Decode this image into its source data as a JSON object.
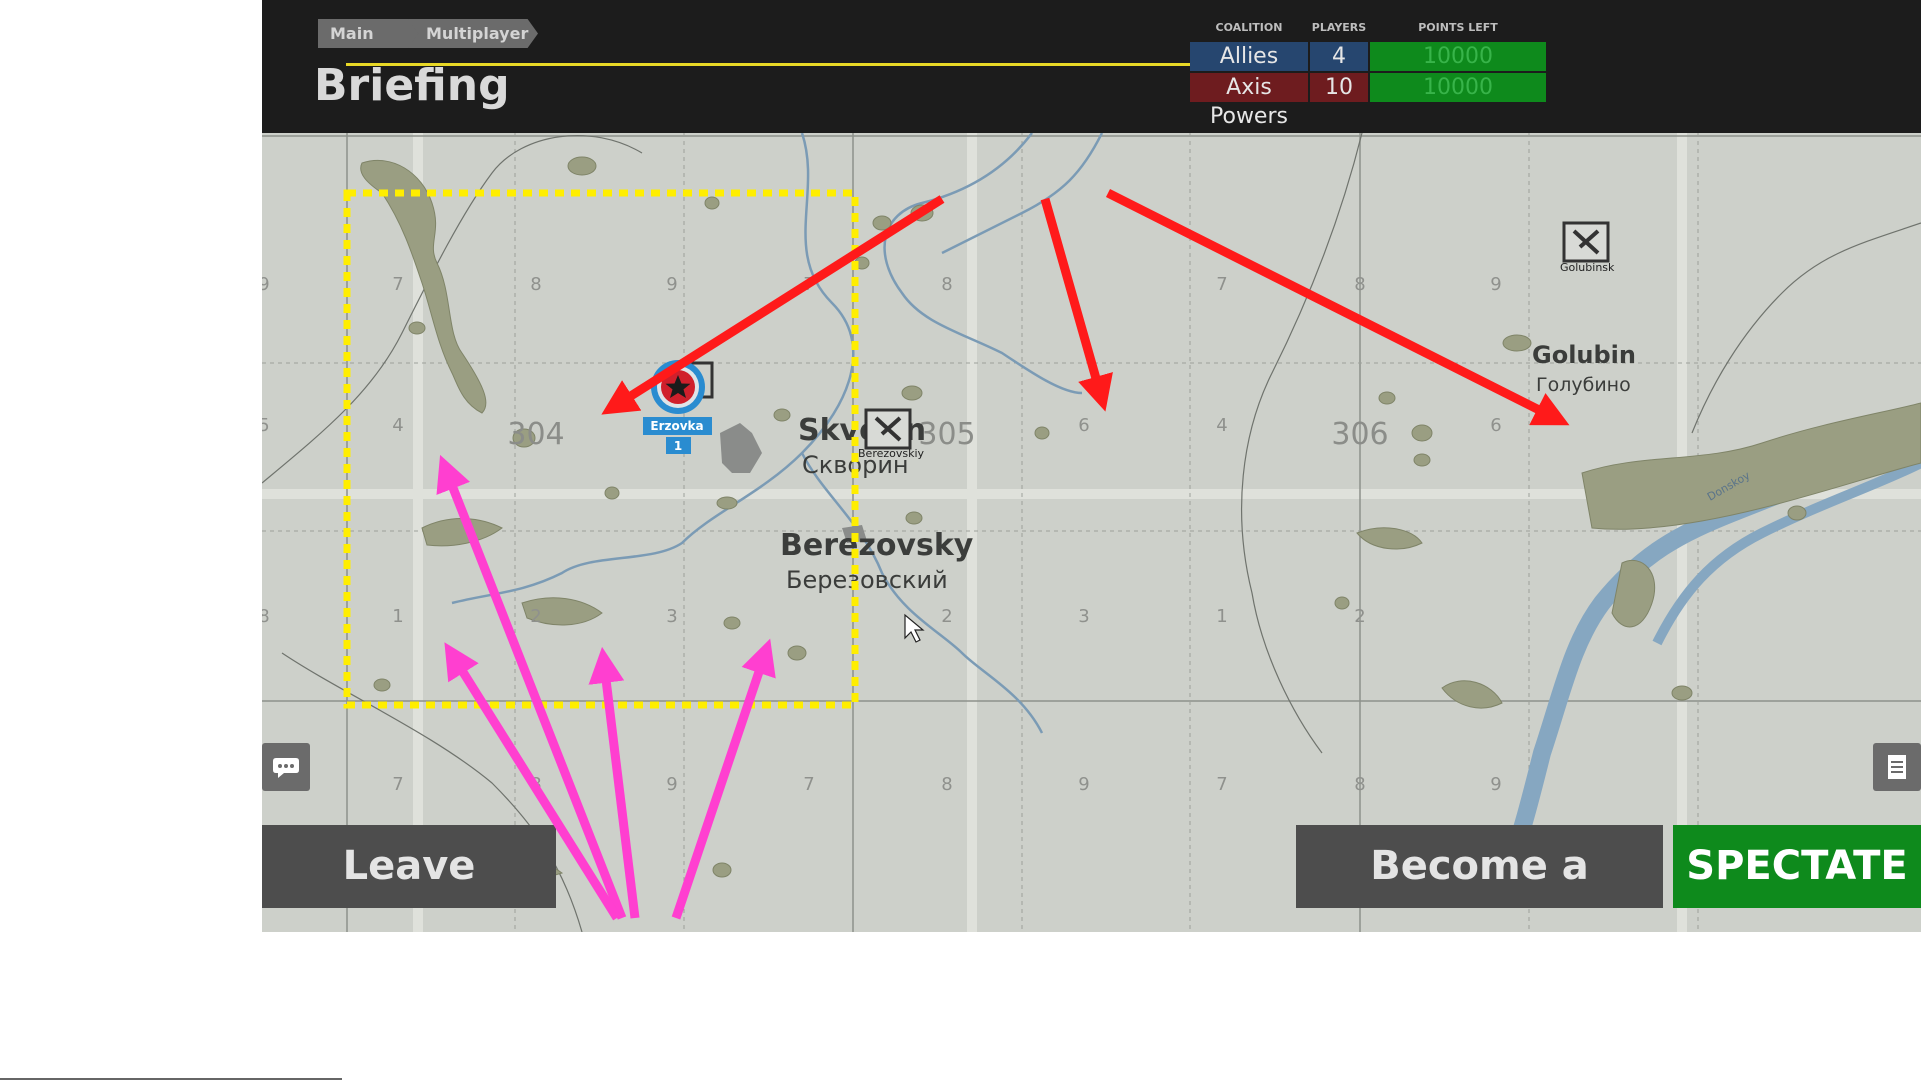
{
  "breadcrumb": {
    "home": "Main Menu",
    "multiplayer": "Multiplayer"
  },
  "page_title": "Briefing",
  "coalition_table": {
    "headers": {
      "coalition": "COALITION",
      "players": "PLAYERS",
      "points_left": "POINTS LEFT"
    },
    "rows": [
      {
        "name": "Allies",
        "players": "4",
        "points": "10000"
      },
      {
        "name": "Axis Powers",
        "players": "10",
        "points": "10000"
      }
    ]
  },
  "map": {
    "sector_numbers": [
      "304",
      "305",
      "306"
    ],
    "grid_digits": {
      "row7": [
        "7",
        "8",
        "9",
        "7",
        "8",
        "9",
        "7",
        "8",
        "9"
      ],
      "row4": [
        "4",
        "6",
        "4",
        "6"
      ],
      "row1": [
        "1",
        "2",
        "3",
        "2",
        "3",
        "1",
        "2",
        "3"
      ],
      "row7b": [
        "7",
        "8",
        "9",
        "7",
        "8",
        "9",
        "7",
        "8",
        "9"
      ],
      "edge": [
        "9",
        "5",
        "8"
      ]
    },
    "towns": [
      {
        "name": "Skvorin",
        "name_ru": "Скворин"
      },
      {
        "name": "Berezovsky",
        "name_ru": "Березовский",
        "marker_label": "Berezovskiy"
      },
      {
        "name": "Golubin",
        "name_ru": "Голубино",
        "marker_label": "Golubinsk"
      }
    ],
    "spawn": {
      "name": "Erzovka",
      "count": "1"
    },
    "river_label": "Donskoy"
  },
  "buttons": {
    "leave": "Leave Server",
    "gunner": "Become a Gunner",
    "spectate": "SPECTATE"
  },
  "colors": {
    "allies": "#26466f",
    "axis": "#6e1c1f",
    "points": "#0e8a1c",
    "title_line": "#e8d826",
    "annotation_red": "#ff1a1a",
    "annotation_pink": "#ff3fd0",
    "selection_box": "#ffee00"
  },
  "icons": [
    "chat-icon",
    "notes-icon",
    "cursor-icon",
    "star-spawn-icon",
    "airfield-icon"
  ]
}
